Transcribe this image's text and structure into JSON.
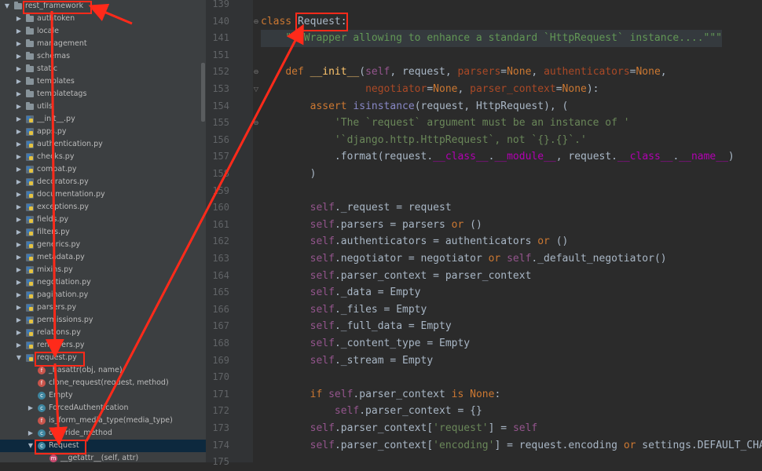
{
  "project_tree": {
    "root": "rest_framework",
    "items": [
      {
        "label": "rest_framework",
        "kind": "folder",
        "depth": 0,
        "expanded": true
      },
      {
        "label": "authtoken",
        "kind": "folder",
        "depth": 1
      },
      {
        "label": "locale",
        "kind": "folder",
        "depth": 1
      },
      {
        "label": "management",
        "kind": "folder",
        "depth": 1
      },
      {
        "label": "schemas",
        "kind": "folder",
        "depth": 1
      },
      {
        "label": "static",
        "kind": "folder",
        "depth": 1
      },
      {
        "label": "templates",
        "kind": "folder",
        "depth": 1
      },
      {
        "label": "templatetags",
        "kind": "folder",
        "depth": 1
      },
      {
        "label": "utils",
        "kind": "folder",
        "depth": 1
      },
      {
        "label": "__init__.py",
        "kind": "py",
        "depth": 1
      },
      {
        "label": "apps.py",
        "kind": "py",
        "depth": 1
      },
      {
        "label": "authentication.py",
        "kind": "py",
        "depth": 1
      },
      {
        "label": "checks.py",
        "kind": "py",
        "depth": 1
      },
      {
        "label": "compat.py",
        "kind": "py",
        "depth": 1
      },
      {
        "label": "decorators.py",
        "kind": "py",
        "depth": 1
      },
      {
        "label": "documentation.py",
        "kind": "py",
        "depth": 1
      },
      {
        "label": "exceptions.py",
        "kind": "py",
        "depth": 1
      },
      {
        "label": "fields.py",
        "kind": "py",
        "depth": 1
      },
      {
        "label": "filters.py",
        "kind": "py",
        "depth": 1
      },
      {
        "label": "generics.py",
        "kind": "py",
        "depth": 1
      },
      {
        "label": "metadata.py",
        "kind": "py",
        "depth": 1
      },
      {
        "label": "mixins.py",
        "kind": "py",
        "depth": 1
      },
      {
        "label": "negotiation.py",
        "kind": "py",
        "depth": 1
      },
      {
        "label": "pagination.py",
        "kind": "py",
        "depth": 1
      },
      {
        "label": "parsers.py",
        "kind": "py",
        "depth": 1
      },
      {
        "label": "permissions.py",
        "kind": "py",
        "depth": 1
      },
      {
        "label": "relations.py",
        "kind": "py",
        "depth": 1
      },
      {
        "label": "renderers.py",
        "kind": "py",
        "depth": 1
      },
      {
        "label": "request.py",
        "kind": "py",
        "depth": 1,
        "expanded": true
      },
      {
        "label": "_hasattr(obj, name)",
        "kind": "func",
        "depth": 2
      },
      {
        "label": "clone_request(request, method)",
        "kind": "func",
        "depth": 2
      },
      {
        "label": "Empty",
        "kind": "cls",
        "depth": 2
      },
      {
        "label": "ForcedAuthentication",
        "kind": "cls",
        "depth": 2,
        "collapsed": true
      },
      {
        "label": "is_form_media_type(media_type)",
        "kind": "func",
        "depth": 2
      },
      {
        "label": "override_method",
        "kind": "cls",
        "depth": 2,
        "collapsed": true
      },
      {
        "label": "Request",
        "kind": "cls",
        "depth": 2,
        "expanded": true,
        "selected": true
      },
      {
        "label": "__getattr__(self, attr)",
        "kind": "meth",
        "depth": 3
      }
    ]
  },
  "icons": {
    "folder": "folder-icon",
    "py": "python-file-icon",
    "func": "function-icon",
    "cls": "class-icon",
    "meth": "method-icon"
  },
  "editor": {
    "line_numbers": [
      "139",
      "140",
      "141",
      "151",
      "152",
      "153",
      "154",
      "155",
      "156",
      "157",
      "158",
      "159",
      "160",
      "161",
      "162",
      "163",
      "164",
      "165",
      "166",
      "167",
      "168",
      "169",
      "170",
      "171",
      "172",
      "173",
      "174",
      "175"
    ],
    "lines": [
      "",
      "class Request:",
      "    \"\"\"Wrapper allowing to enhance a standard `HttpRequest` instance....\"\"\"",
      "",
      "    def __init__(self, request, parsers=None, authenticators=None,",
      "                 negotiator=None, parser_context=None):",
      "        assert isinstance(request, HttpRequest), (",
      "            'The `request` argument must be an instance of '",
      "            '`django.http.HttpRequest`, not `{}.{}`.'",
      "            .format(request.__class__.__module__, request.__class__.__name__)",
      "        )",
      "",
      "        self._request = request",
      "        self.parsers = parsers or ()",
      "        self.authenticators = authenticators or ()",
      "        self.negotiator = negotiator or self._default_negotiator()",
      "        self.parser_context = parser_context",
      "        self._data = Empty",
      "        self._files = Empty",
      "        self._full_data = Empty",
      "        self._content_type = Empty",
      "        self._stream = Empty",
      "",
      "        if self.parser_context is None:",
      "            self.parser_context = {}",
      "        self.parser_context['request'] = self",
      "        self.parser_context['encoding'] = request.encoding or settings.DEFAULT_CHARSET",
      ""
    ]
  },
  "annotation_color": "#ff2a1a"
}
